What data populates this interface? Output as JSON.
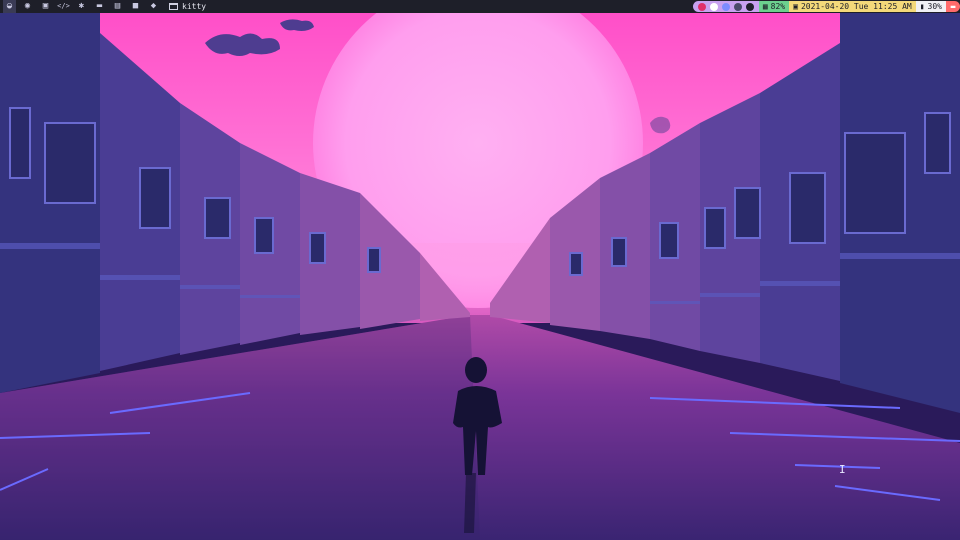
{
  "topbar": {
    "workspaces": [
      {
        "icon": "arch-logo-icon",
        "glyph": "◒",
        "active": true
      },
      {
        "icon": "firefox-icon",
        "glyph": "◉",
        "active": false
      },
      {
        "icon": "discord-icon",
        "glyph": "▣",
        "active": false
      },
      {
        "icon": "code-icon",
        "glyph": "</>",
        "active": false
      },
      {
        "icon": "settings-icon",
        "glyph": "✱",
        "active": false
      },
      {
        "icon": "folder-icon",
        "glyph": "▬",
        "active": false
      },
      {
        "icon": "image-icon",
        "glyph": "▤",
        "active": false
      },
      {
        "icon": "video-icon",
        "glyph": "■",
        "active": false
      },
      {
        "icon": "layers-icon",
        "glyph": "◆",
        "active": false
      }
    ],
    "window_title": "kitty",
    "memory": "82%",
    "clock": "2021-04-20 Tue 11:25 AM",
    "battery": "30%"
  },
  "colors": {
    "bar_bg": "#1e1f29",
    "tray": "#c8a2f0",
    "memory": "#6cd08e",
    "clock": "#f4d97a",
    "battery": "#f0f0f4",
    "power": "#ff6b6b",
    "sky": "#ff5fd0",
    "sun": "#ff9ef0",
    "road": "#5a2a80"
  }
}
